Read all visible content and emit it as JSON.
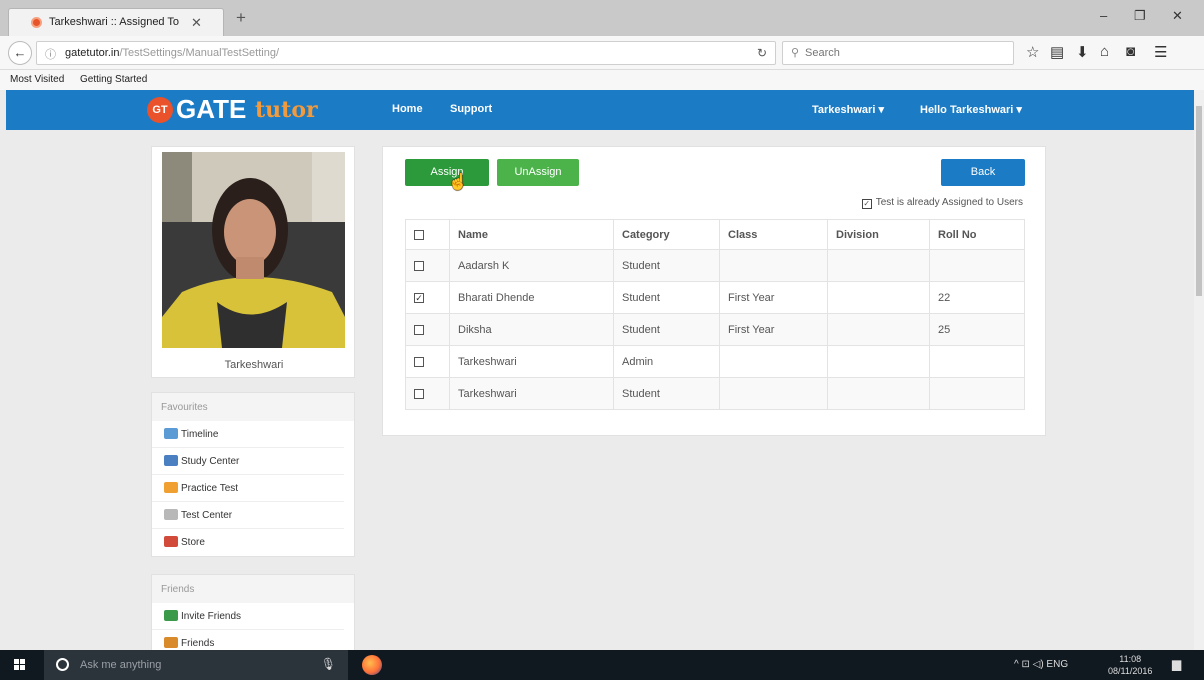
{
  "browser": {
    "tab_title": "Tarkeshwari :: Assigned To",
    "tab_close": "✕",
    "new_tab": "+",
    "window_minimize": "–",
    "window_maximize": "❐",
    "window_close": "✕",
    "url_host": "gatetutor.in",
    "url_path": "/TestSettings/ManualTestSetting/",
    "search_placeholder": "Search",
    "bookmarks": [
      "Most Visited",
      "Getting Started"
    ]
  },
  "site": {
    "logo_badge": "GT",
    "logo_main": "GATE",
    "logo_accent": "tutor",
    "nav_home": "Home",
    "nav_support": "Support",
    "nav_user": "Tarkeshwari ▾",
    "nav_greeting": "Hello Tarkeshwari ▾"
  },
  "sidebar": {
    "profile_name": "Tarkeshwari",
    "favourites_title": "Favourites",
    "favourites": [
      {
        "label": "Timeline",
        "icon": "timeline-icon",
        "color": "#5b9bd5"
      },
      {
        "label": "Study Center",
        "icon": "study-center-icon",
        "color": "#4a7fc1"
      },
      {
        "label": "Practice Test",
        "icon": "practice-test-icon",
        "color": "#f0a030"
      },
      {
        "label": "Test Center",
        "icon": "test-center-icon",
        "color": "#b8b8b8"
      },
      {
        "label": "Store",
        "icon": "store-icon",
        "color": "#d14a3a"
      }
    ],
    "friends_title": "Friends",
    "friends": [
      {
        "label": "Invite Friends",
        "icon": "invite-friends-icon",
        "color": "#3a9a4a"
      },
      {
        "label": "Friends",
        "icon": "friends-icon",
        "color": "#d98a2a"
      }
    ]
  },
  "main": {
    "assign_label": "Assign",
    "unassign_label": "UnAssign",
    "back_label": "Back",
    "note": "Test is already Assigned to Users",
    "columns": [
      "Name",
      "Category",
      "Class",
      "Division",
      "Roll No"
    ],
    "rows": [
      {
        "name": "Aadarsh K",
        "category": "Student",
        "class": "",
        "division": "",
        "roll": "",
        "checked": false
      },
      {
        "name": "Bharati Dhende",
        "category": "Student",
        "class": "First Year",
        "division": "",
        "roll": "22",
        "checked": true
      },
      {
        "name": "Diksha",
        "category": "Student",
        "class": "First Year",
        "division": "",
        "roll": "25",
        "checked": false
      },
      {
        "name": "Tarkeshwari",
        "category": "Admin",
        "class": "",
        "division": "",
        "roll": "",
        "checked": false
      },
      {
        "name": "Tarkeshwari",
        "category": "Student",
        "class": "",
        "division": "",
        "roll": "",
        "checked": false
      }
    ]
  },
  "taskbar": {
    "search_text": "Ask me anything",
    "tray_text": "^ ⊡ ◁) ENG",
    "time": "11:08",
    "date": "08/11/2016"
  }
}
